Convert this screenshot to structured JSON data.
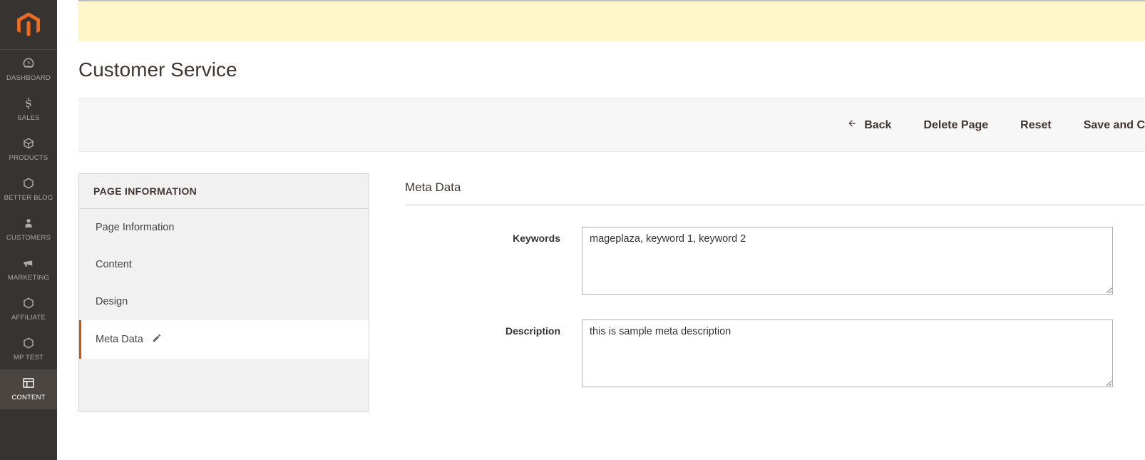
{
  "sidebar": {
    "items": [
      {
        "label": "DASHBOARD"
      },
      {
        "label": "SALES"
      },
      {
        "label": "PRODUCTS"
      },
      {
        "label": "BETTER BLOG"
      },
      {
        "label": "CUSTOMERS"
      },
      {
        "label": "MARKETING"
      },
      {
        "label": "AFFILIATE"
      },
      {
        "label": "MP TEST"
      },
      {
        "label": "CONTENT"
      }
    ]
  },
  "page": {
    "title": "Customer Service"
  },
  "actions": {
    "back": "Back",
    "delete": "Delete Page",
    "reset": "Reset",
    "save_continue": "Save and C"
  },
  "side_panel": {
    "header": "PAGE INFORMATION",
    "tabs": [
      {
        "label": "Page Information"
      },
      {
        "label": "Content"
      },
      {
        "label": "Design"
      },
      {
        "label": "Meta Data"
      }
    ]
  },
  "form": {
    "section_title": "Meta Data",
    "keywords_label": "Keywords",
    "keywords_value": "mageplaza, keyword 1, keyword 2",
    "description_label": "Description",
    "description_value": "this is sample meta description"
  }
}
